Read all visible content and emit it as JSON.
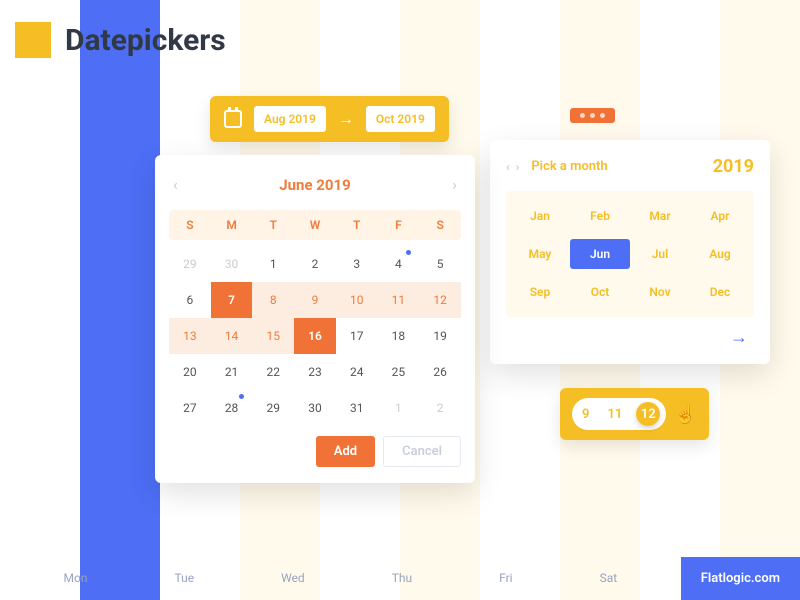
{
  "title": "Datepickers",
  "range": {
    "from": "Aug 2019",
    "to": "Oct 2019"
  },
  "calendar": {
    "title": "June 2019",
    "dow": [
      "S",
      "M",
      "T",
      "W",
      "T",
      "F",
      "S"
    ],
    "days": [
      {
        "n": "29",
        "cls": "mute"
      },
      {
        "n": "30",
        "cls": "mute"
      },
      {
        "n": "1"
      },
      {
        "n": "2"
      },
      {
        "n": "3"
      },
      {
        "n": "4",
        "cls": "dot"
      },
      {
        "n": "5"
      },
      {
        "n": "6"
      },
      {
        "n": "7",
        "cls": "sel"
      },
      {
        "n": "8",
        "cls": "hl"
      },
      {
        "n": "9",
        "cls": "hl"
      },
      {
        "n": "10",
        "cls": "hl"
      },
      {
        "n": "11",
        "cls": "hl"
      },
      {
        "n": "12",
        "cls": "hl"
      },
      {
        "n": "13",
        "cls": "hl"
      },
      {
        "n": "14",
        "cls": "hl"
      },
      {
        "n": "15",
        "cls": "hl"
      },
      {
        "n": "16",
        "cls": "sel"
      },
      {
        "n": "17"
      },
      {
        "n": "18"
      },
      {
        "n": "19"
      },
      {
        "n": "20"
      },
      {
        "n": "21"
      },
      {
        "n": "22"
      },
      {
        "n": "23"
      },
      {
        "n": "24"
      },
      {
        "n": "25"
      },
      {
        "n": "26"
      },
      {
        "n": "27"
      },
      {
        "n": "28",
        "cls": "dot"
      },
      {
        "n": "29"
      },
      {
        "n": "30"
      },
      {
        "n": "31"
      },
      {
        "n": "1",
        "cls": "mute"
      },
      {
        "n": "2",
        "cls": "mute"
      }
    ],
    "add": "Add",
    "cancel": "Cancel"
  },
  "monthPicker": {
    "label": "Pick a month",
    "year": "2019",
    "months": [
      "Jan",
      "Feb",
      "Mar",
      "Apr",
      "May",
      "Jun",
      "Jul",
      "Aug",
      "Sep",
      "Oct",
      "Nov",
      "Dec"
    ],
    "active": "Jun"
  },
  "hours": {
    "a": "9",
    "b": "11",
    "c": "12"
  },
  "footer": {
    "days": [
      "Mon",
      "Tue",
      "Wed",
      "Thu",
      "Fri",
      "Sat"
    ],
    "brand": "Flatlogic.com"
  }
}
